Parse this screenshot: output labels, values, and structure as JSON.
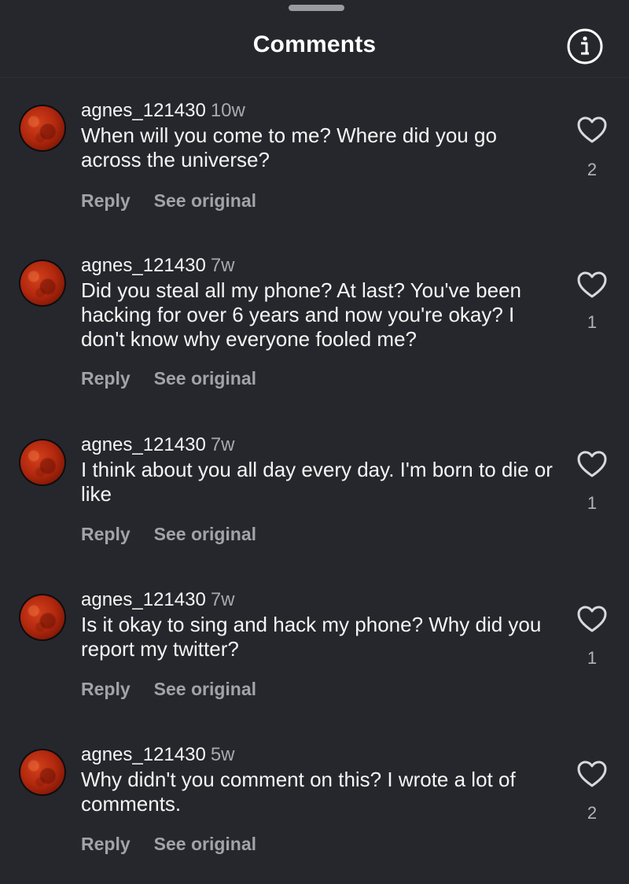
{
  "header": {
    "title": "Comments",
    "info_icon": "info-icon"
  },
  "comments": [
    {
      "username": "agnes_121430",
      "time": "10w",
      "text": "When will you come to me? Where did you go across the universe?",
      "reply_label": "Reply",
      "see_original_label": "See original",
      "likes": "2"
    },
    {
      "username": "agnes_121430",
      "time": "7w",
      "text": "Did you steal all my phone? At last? You've been hacking for over 6 years and now you're okay? I don't know why everyone fooled me?",
      "reply_label": "Reply",
      "see_original_label": "See original",
      "likes": "1"
    },
    {
      "username": "agnes_121430",
      "time": "7w",
      "text": "I think about you all day every day. I'm born to die or like",
      "reply_label": "Reply",
      "see_original_label": "See original",
      "likes": "1"
    },
    {
      "username": "agnes_121430",
      "time": "7w",
      "text": "Is it okay to sing and hack my phone? Why did you report my twitter?",
      "reply_label": "Reply",
      "see_original_label": "See original",
      "likes": "1"
    },
    {
      "username": "agnes_121430",
      "time": "5w",
      "text": "Why didn't you comment on this? I wrote a lot of comments.",
      "reply_label": "Reply",
      "see_original_label": "See original",
      "likes": "2"
    }
  ],
  "colors": {
    "background": "#26272c",
    "text": "#f5f5f5",
    "muted": "#a2a3a8",
    "avatar_moon": "#b3290f"
  }
}
